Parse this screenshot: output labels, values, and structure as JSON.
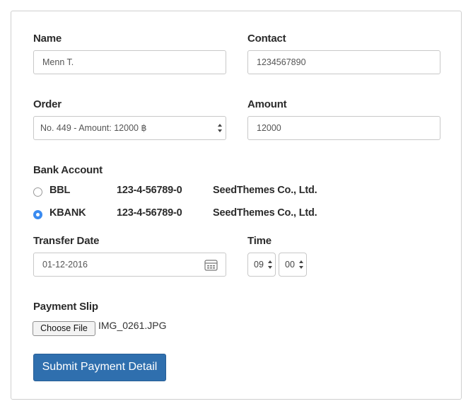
{
  "form": {
    "name": {
      "label": "Name",
      "value": "Menn T."
    },
    "contact": {
      "label": "Contact",
      "value": "1234567890"
    },
    "order": {
      "label": "Order",
      "selected": "No. 449 - Amount: 12000 ฿"
    },
    "amount": {
      "label": "Amount",
      "value": "12000"
    },
    "bank_account": {
      "label": "Bank Account",
      "options": [
        {
          "bank": "BBL",
          "account": "123-4-56789-0",
          "company": "SeedThemes Co., Ltd.",
          "checked": false
        },
        {
          "bank": "KBANK",
          "account": "123-4-56789-0",
          "company": "SeedThemes Co., Ltd.",
          "checked": true
        }
      ]
    },
    "transfer_date": {
      "label": "Transfer Date",
      "value": "01-12-2016",
      "icon": "calendar-icon"
    },
    "time": {
      "label": "Time",
      "hour": "09",
      "minute": "00"
    },
    "payment_slip": {
      "label": "Payment Slip",
      "button": "Choose File",
      "file_name": "IMG_0261.JPG"
    },
    "submit": {
      "label": "Submit Payment Detail"
    }
  },
  "colors": {
    "submit_bg": "#2f6fae",
    "radio_checked": "#3a8bf0"
  }
}
